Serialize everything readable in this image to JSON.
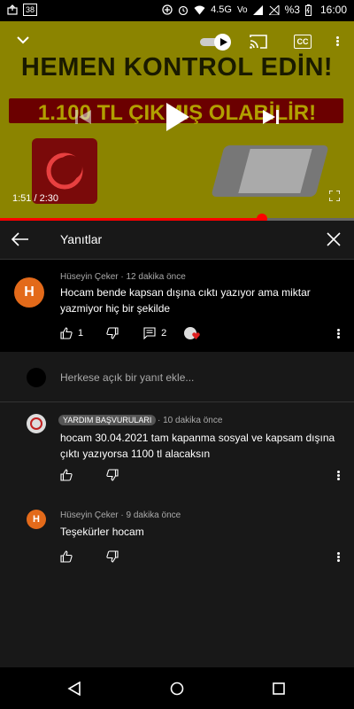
{
  "status_bar": {
    "badge_left": "38",
    "network": "4.5G",
    "volte": "Vo",
    "battery": "%3",
    "time": "16:00"
  },
  "video": {
    "headline": "HEMEN KONTROL EDİN!",
    "banner": "1.100 TL ÇIKMIŞ OLABİLİR!",
    "time_display": "1:51 / 2:30",
    "progress_fraction": 0.74,
    "cc_label": "CC"
  },
  "panel": {
    "title": "Yanıtlar"
  },
  "comments": [
    {
      "author": "Hüseyin Çeker",
      "time": "12 dakika önce",
      "text": "Hocam bende kapsan dışına cıktı yazıyor ama miktar yazmiyor hiç bir şekilde",
      "avatar_letter": "H",
      "likes": "1",
      "replies": "2"
    },
    {
      "author_badge": "YARDIM BAŞVURULARI",
      "time": "10 dakika önce",
      "text": "hocam 30.04.2021 tam kapanma sosyal ve kapsam dışına çıktı yazıyorsa 1100 tl alacaksın"
    },
    {
      "author": "Hüseyin Çeker",
      "time": "9 dakika önce",
      "text": "Teşekürler hocam",
      "avatar_letter": "H"
    }
  ],
  "reply_box": {
    "placeholder": "Herkese açık bir yanıt ekle..."
  },
  "colors": {
    "accent": "#ff0000",
    "avatar": "#e36a1a",
    "panel_bg": "#181818"
  }
}
